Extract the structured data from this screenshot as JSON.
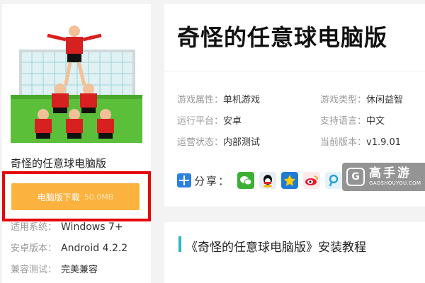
{
  "left": {
    "game_name": "奇怪的任意球电脑版",
    "download_label": "电脑版下载",
    "download_size": "50.0MB",
    "info": [
      {
        "label": "适用系统：",
        "value": "Windows 7+"
      },
      {
        "label": "安卓版本：",
        "value": "Android 4.2.2"
      },
      {
        "label": "兼容测试：",
        "value": "完美兼容"
      }
    ]
  },
  "header": {
    "title": "奇怪的任意球电脑版"
  },
  "attrs": {
    "left": [
      {
        "label": "游戏属性：",
        "value": "单机游戏"
      },
      {
        "label": "运行平台：",
        "value": "安卓"
      },
      {
        "label": "运营状态：",
        "value": "内部测试"
      }
    ],
    "right": [
      {
        "label": "游戏类型：",
        "value": "休闲益智"
      },
      {
        "label": "支持语言：",
        "value": "中文"
      },
      {
        "label": "当前版本：",
        "value": "v1.9.01"
      }
    ]
  },
  "share": {
    "label": "分享：",
    "icons": [
      "wechat-icon",
      "qq-icon",
      "qzone-icon",
      "weibo-icon",
      "tencent-weibo-icon"
    ]
  },
  "watermark": {
    "name": "高手游",
    "url": "GAOSHOUYOU.COM"
  },
  "tutorial": {
    "title": "《奇怪的任意球电脑版》安装教程"
  },
  "colors": {
    "download": "#fbb23f",
    "highlight_frame": "#e4070b",
    "accent_bar": "#2ab7c4",
    "share_plus": "#2d7fe0"
  }
}
